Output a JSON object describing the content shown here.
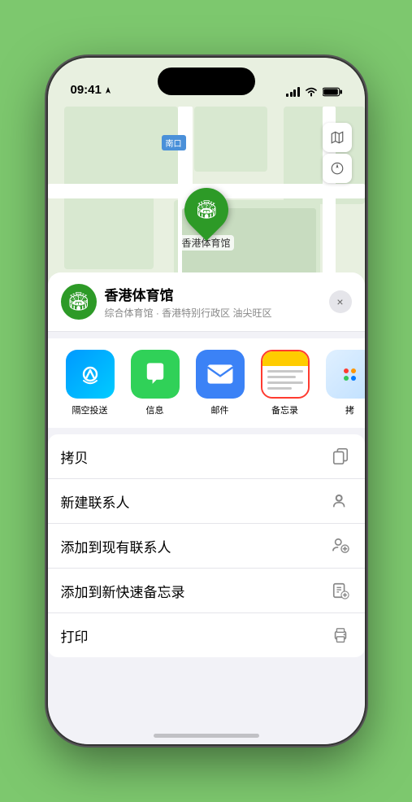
{
  "status_bar": {
    "time": "09:41",
    "location_arrow": "▶"
  },
  "map": {
    "label": "南口",
    "marker_name": "香港体育馆",
    "marker_label": "香港体育馆"
  },
  "place_card": {
    "name": "香港体育馆",
    "subtitle": "综合体育馆 · 香港特别行政区 油尖旺区",
    "close_label": "×"
  },
  "share_items": [
    {
      "label": "隔空投送",
      "type": "airdrop"
    },
    {
      "label": "信息",
      "type": "messages"
    },
    {
      "label": "邮件",
      "type": "mail"
    },
    {
      "label": "备忘录",
      "type": "notes",
      "highlighted": true
    },
    {
      "label": "拷",
      "type": "more"
    }
  ],
  "actions": [
    {
      "label": "拷贝",
      "icon": "copy"
    },
    {
      "label": "新建联系人",
      "icon": "person-add"
    },
    {
      "label": "添加到现有联系人",
      "icon": "person-plus"
    },
    {
      "label": "添加到新快速备忘录",
      "icon": "note-add"
    },
    {
      "label": "打印",
      "icon": "print"
    }
  ],
  "colors": {
    "green_accent": "#2d9a27",
    "red_highlight": "#ff3b30",
    "blue_accent": "#3b82f6"
  }
}
